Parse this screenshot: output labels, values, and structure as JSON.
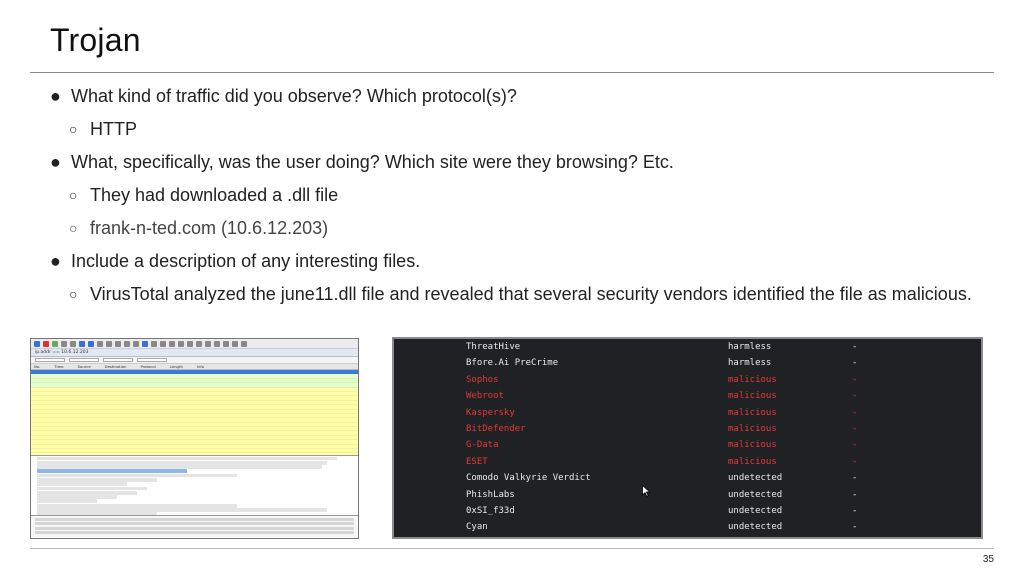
{
  "slide": {
    "title": "Trojan",
    "page_number": "35"
  },
  "bullets": [
    {
      "level": 1,
      "marker": "●",
      "text": "What kind of traffic did you observe? Which protocol(s)?"
    },
    {
      "level": 2,
      "marker": "○",
      "text": "HTTP"
    },
    {
      "level": 1,
      "marker": "●",
      "text": "What, specifically, was the user doing? Which site were they browsing? Etc."
    },
    {
      "level": 2,
      "marker": "○",
      "text": "They had downloaded a .dll file"
    },
    {
      "level": 2,
      "marker": "○",
      "text": "frank-n-ted.com (10.6.12.203)",
      "muted": true
    },
    {
      "level": 1,
      "marker": "●",
      "text": "Include a description of any interesting files."
    },
    {
      "level": 2,
      "marker": "○",
      "text": "VirusTotal analyzed the june11.dll file and revealed that several security vendors identified the file as malicious."
    }
  ],
  "virustotal": {
    "colors": {
      "background": "#202124",
      "text": "#e8eaed",
      "malicious": "#e53935"
    },
    "rows": [
      {
        "vendor": "ThreatHive",
        "result": "harmless",
        "value": "-",
        "status": "normal"
      },
      {
        "vendor": "Bfore.Ai PreCrime",
        "result": "harmless",
        "value": "-",
        "status": "normal"
      },
      {
        "vendor": "Sophos",
        "result": "malicious",
        "value": "-",
        "status": "malicious"
      },
      {
        "vendor": "Webroot",
        "result": "malicious",
        "value": "-",
        "status": "malicious"
      },
      {
        "vendor": "Kaspersky",
        "result": "malicious",
        "value": "-",
        "status": "malicious"
      },
      {
        "vendor": "BitDefender",
        "result": "malicious",
        "value": "-",
        "status": "malicious"
      },
      {
        "vendor": "G-Data",
        "result": "malicious",
        "value": "-",
        "status": "malicious"
      },
      {
        "vendor": "ESET",
        "result": "malicious",
        "value": "-",
        "status": "malicious"
      },
      {
        "vendor": "Comodo Valkyrie Verdict",
        "result": "undetected",
        "value": "-",
        "status": "normal"
      },
      {
        "vendor": "PhishLabs",
        "result": "undetected",
        "value": "-",
        "status": "normal"
      },
      {
        "vendor": "0xSI_f33d",
        "result": "undetected",
        "value": "-",
        "status": "normal"
      },
      {
        "vendor": "Cyan",
        "result": "undetected",
        "value": "-",
        "status": "normal"
      }
    ]
  },
  "wireshark": {
    "filter": "ip.addr == 10.6.12.203",
    "columns": [
      "No.",
      "Time",
      "Source",
      "Destination",
      "Protocol",
      "Length",
      "Info"
    ],
    "colors": {
      "selected": "#3d7bd9",
      "http": "#e4ffc7",
      "browser": "#ffffa8",
      "details_highlight": "#8fb4e8"
    },
    "rows": [
      "selected",
      "http",
      "http",
      "http",
      "browser",
      "browser",
      "browser",
      "browser",
      "browser",
      "browser",
      "browser",
      "browser",
      "browser",
      "browser",
      "browser",
      "browser",
      "browser",
      "browser",
      "browser",
      "browser",
      "browser"
    ]
  }
}
